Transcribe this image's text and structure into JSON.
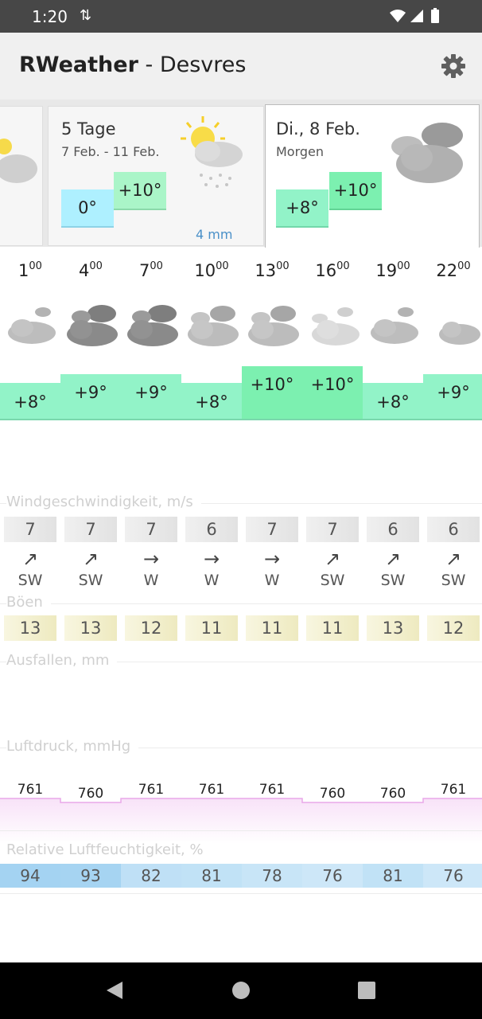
{
  "status": {
    "time": "1:20",
    "sync_icon": "data-sync-icon"
  },
  "app": {
    "title_bold": "RWeather",
    "title_rest": " - Desvres"
  },
  "cards": [
    {
      "title": "5 Tage",
      "subtitle": "7 Feb. - 11 Feb.",
      "temp_low": "0°",
      "temp_high": "+10°",
      "precip": "4 mm",
      "icon": "sun-cloud-rain-icon"
    },
    {
      "title": "Di., 8 Feb.",
      "subtitle": "Morgen",
      "temp_low": "+8°",
      "temp_high": "+10°",
      "icon": "cloudy-icon"
    }
  ],
  "hourly": {
    "hours": [
      {
        "h": "1",
        "m": "00",
        "icon": "cloudy-light-icon",
        "temp": "+8°",
        "level": 0
      },
      {
        "h": "4",
        "m": "00",
        "icon": "cloudy-dark-icon",
        "temp": "+9°",
        "level": 1
      },
      {
        "h": "7",
        "m": "00",
        "icon": "cloudy-dark-icon",
        "temp": "+9°",
        "level": 1
      },
      {
        "h": "10",
        "m": "00",
        "icon": "cloudy-icon",
        "temp": "+8°",
        "level": 0
      },
      {
        "h": "13",
        "m": "00",
        "icon": "cloudy-icon",
        "temp": "+10°",
        "level": 2
      },
      {
        "h": "16",
        "m": "00",
        "icon": "cloudy-pale-icon",
        "temp": "+10°",
        "level": 2
      },
      {
        "h": "19",
        "m": "00",
        "icon": "cloudy-light-icon",
        "temp": "+8°",
        "level": 0
      },
      {
        "h": "22",
        "m": "00",
        "icon": "moon-cloud-icon",
        "temp": "+9°",
        "level": 1
      }
    ]
  },
  "wind": {
    "label": "Windgeschwindigkeit, m/s",
    "speeds": [
      "7",
      "7",
      "7",
      "6",
      "7",
      "7",
      "6",
      "6"
    ],
    "dirs": [
      {
        "arrow": "↗",
        "label": "SW"
      },
      {
        "arrow": "↗",
        "label": "SW"
      },
      {
        "arrow": "→",
        "label": "W"
      },
      {
        "arrow": "→",
        "label": "W"
      },
      {
        "arrow": "→",
        "label": "W"
      },
      {
        "arrow": "↗",
        "label": "SW"
      },
      {
        "arrow": "↗",
        "label": "SW"
      },
      {
        "arrow": "↗",
        "label": "SW"
      }
    ]
  },
  "gusts": {
    "label": "Böen",
    "values": [
      "13",
      "13",
      "12",
      "11",
      "11",
      "11",
      "13",
      "12"
    ]
  },
  "precipitation": {
    "label": "Ausfallen, mm"
  },
  "pressure": {
    "label": "Luftdruck, mmHg",
    "values": [
      "761",
      "760",
      "761",
      "761",
      "761",
      "760",
      "760",
      "761"
    ]
  },
  "humidity": {
    "label": "Relative Luftfeuchtigkeit, %",
    "values": [
      "94",
      "93",
      "82",
      "81",
      "78",
      "76",
      "81",
      "76"
    ]
  },
  "colors": {
    "temp_fill": "#92f3c8",
    "card_low": "#aef0ff",
    "card_high": "#aaf5c8",
    "humidity_fill": "#b4dcf5"
  }
}
